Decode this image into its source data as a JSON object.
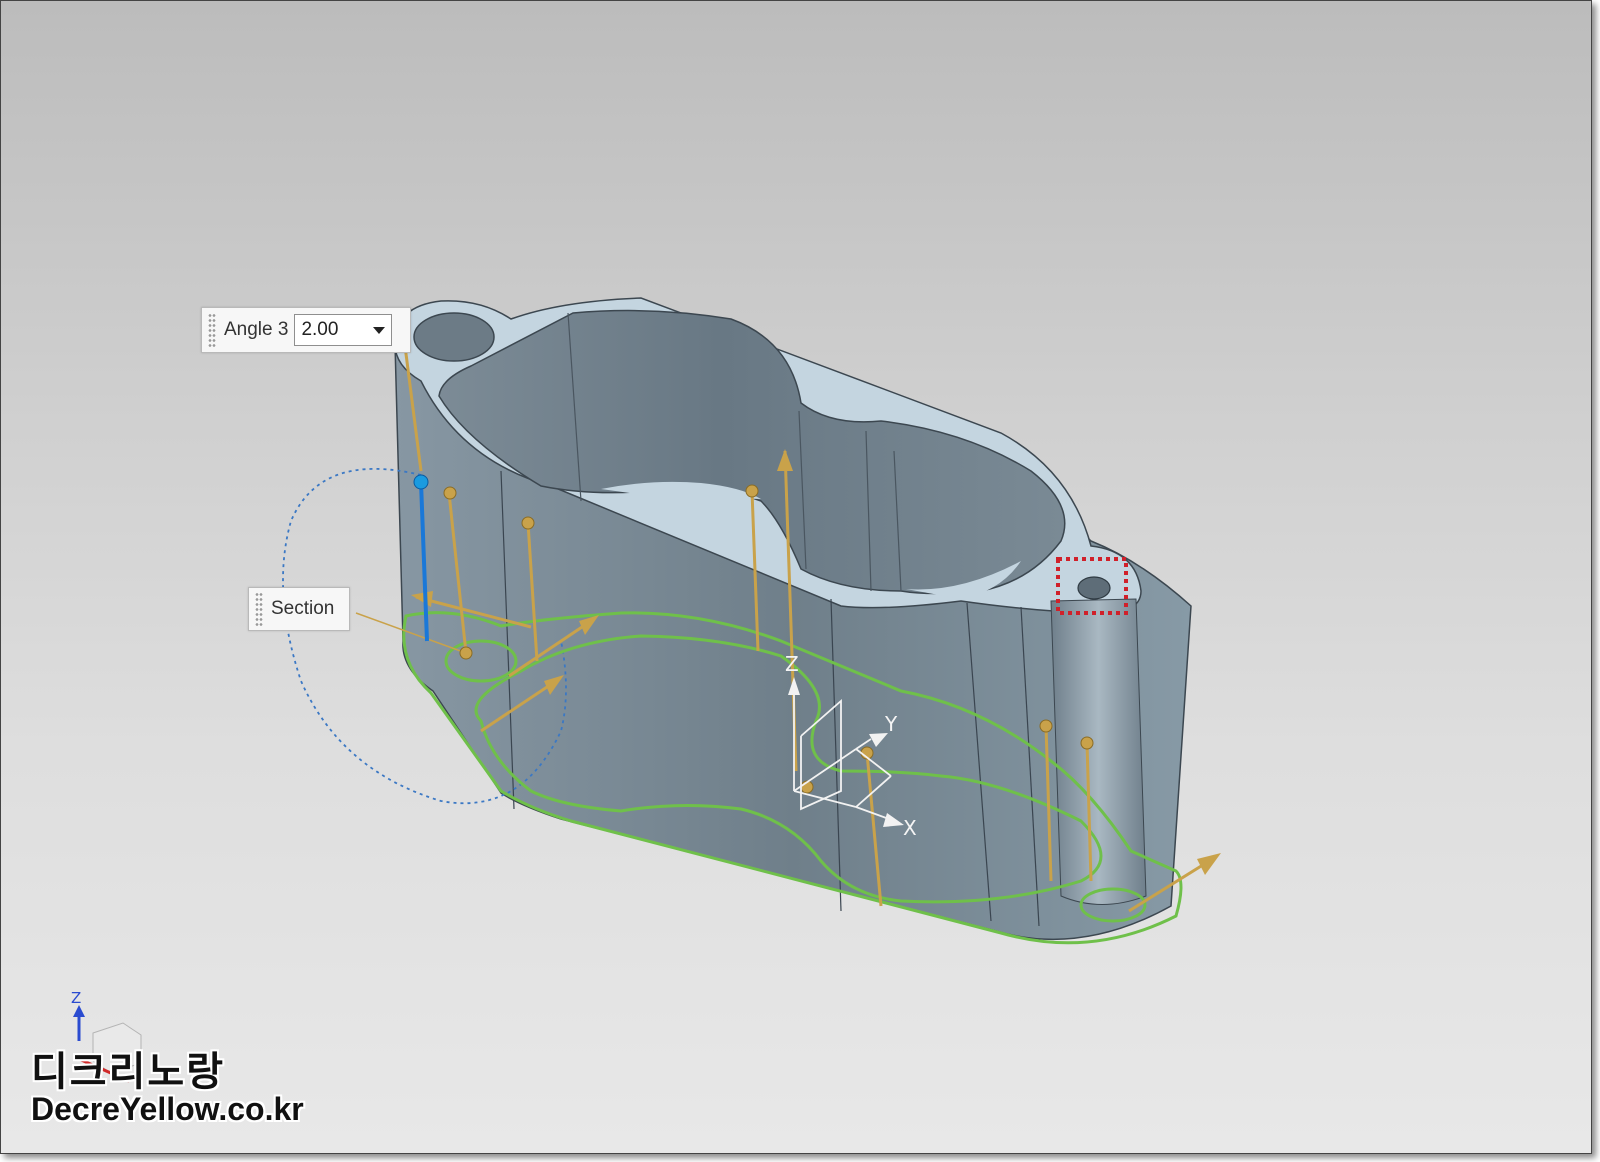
{
  "viewport": {
    "background_top": "#bcbcbc",
    "background_bottom": "#e8e8e8",
    "part_color": "#7d8c97",
    "section_curve_color": "#6fc04a",
    "vector_color": "#c9a24a",
    "highlight_box_color": "#d0202a"
  },
  "angle_handle": {
    "label": "Angle 3",
    "value": "2.00",
    "icon": "dropdown-caret-icon"
  },
  "section_handle": {
    "label": "Section"
  },
  "csys": {
    "x_label": "X",
    "y_label": "Y",
    "z_label": "Z"
  },
  "triad": {
    "z_label": "Z"
  },
  "watermark": {
    "korean": "디크리노랑",
    "url": "DecreYellow.co.kr"
  }
}
